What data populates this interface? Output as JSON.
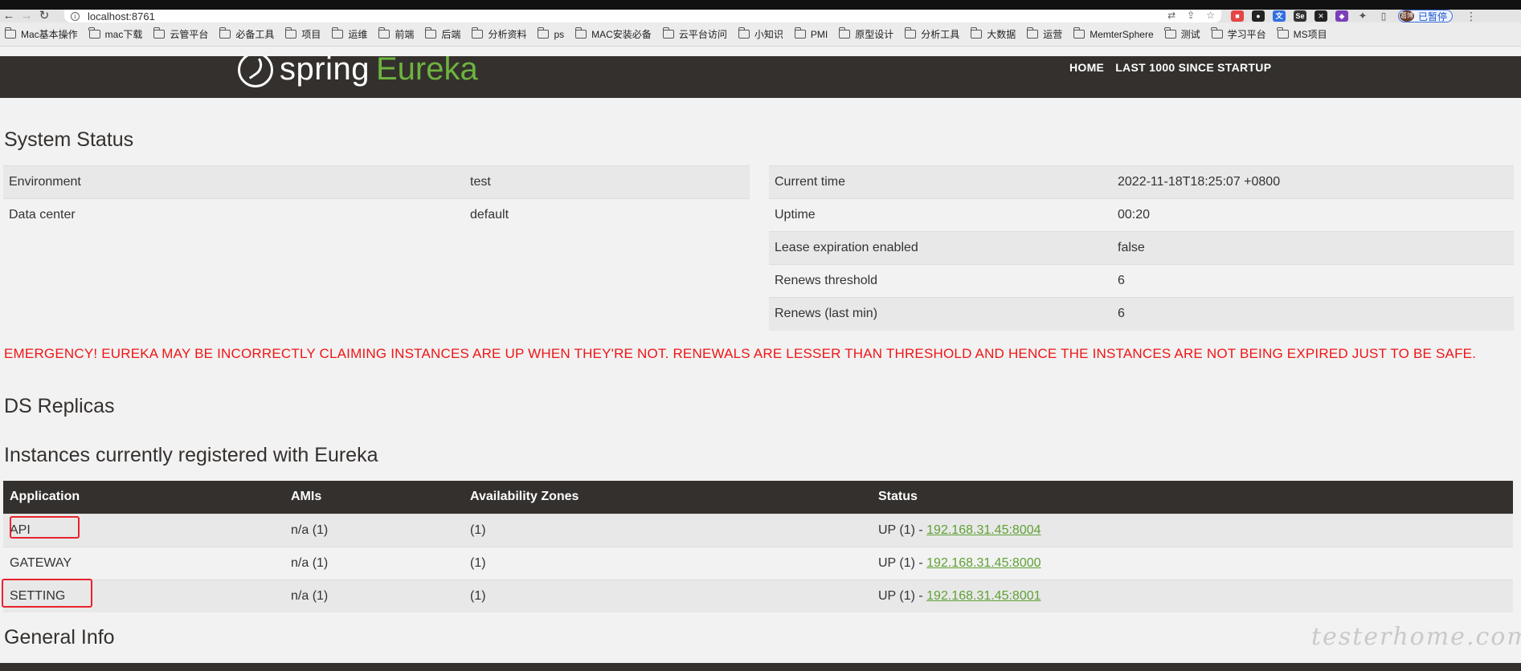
{
  "browser": {
    "url": "localhost:8761",
    "profile_label": "已暂停",
    "avatar_text": "葛博",
    "bookmarks": [
      "Mac基本操作",
      "mac下载",
      "云管平台",
      "必备工具",
      "项目",
      "运维",
      "前端",
      "后端",
      "分析资料",
      "ps",
      "MAC安装必备",
      "云平台访问",
      "小知识",
      "PMI",
      "原型设计",
      "分析工具",
      "大数据",
      "运营",
      "MemterSphere",
      "测试",
      "学习平台",
      "MS项目"
    ]
  },
  "header": {
    "logo_spring": "spring",
    "logo_eureka": "Eureka",
    "nav": [
      "HOME",
      "LAST 1000 SINCE STARTUP"
    ]
  },
  "system_status": {
    "title": "System Status",
    "left": [
      {
        "label": "Environment",
        "value": "test"
      },
      {
        "label": "Data center",
        "value": "default"
      }
    ],
    "right": [
      {
        "label": "Current time",
        "value": "2022-11-18T18:25:07 +0800"
      },
      {
        "label": "Uptime",
        "value": "00:20"
      },
      {
        "label": "Lease expiration enabled",
        "value": "false"
      },
      {
        "label": "Renews threshold",
        "value": "6"
      },
      {
        "label": "Renews (last min)",
        "value": "6"
      }
    ]
  },
  "emergency": "EMERGENCY! EUREKA MAY BE INCORRECTLY CLAIMING INSTANCES ARE UP WHEN THEY'RE NOT. RENEWALS ARE LESSER THAN THRESHOLD AND HENCE THE INSTANCES ARE NOT BEING EXPIRED JUST TO BE SAFE.",
  "ds_replicas": {
    "title": "DS Replicas"
  },
  "instances": {
    "title": "Instances currently registered with Eureka",
    "columns": [
      "Application",
      "AMIs",
      "Availability Zones",
      "Status"
    ],
    "rows": [
      {
        "application": "API",
        "amis": "n/a (1)",
        "zones": "(1)",
        "status": "UP (1) - ",
        "link": "192.168.31.45:8004"
      },
      {
        "application": "GATEWAY",
        "amis": "n/a (1)",
        "zones": "(1)",
        "status": "UP (1) - ",
        "link": "192.168.31.45:8000"
      },
      {
        "application": "SETTING",
        "amis": "n/a (1)",
        "zones": "(1)",
        "status": "UP (1) - ",
        "link": "192.168.31.45:8001"
      }
    ]
  },
  "general_info": {
    "title": "General Info"
  },
  "watermark": "testerhome.com",
  "colors": {
    "navbar": "#34302d",
    "accent_green": "#6db33f",
    "emergency_red": "#f01515",
    "highlight_red": "#e8232d"
  }
}
